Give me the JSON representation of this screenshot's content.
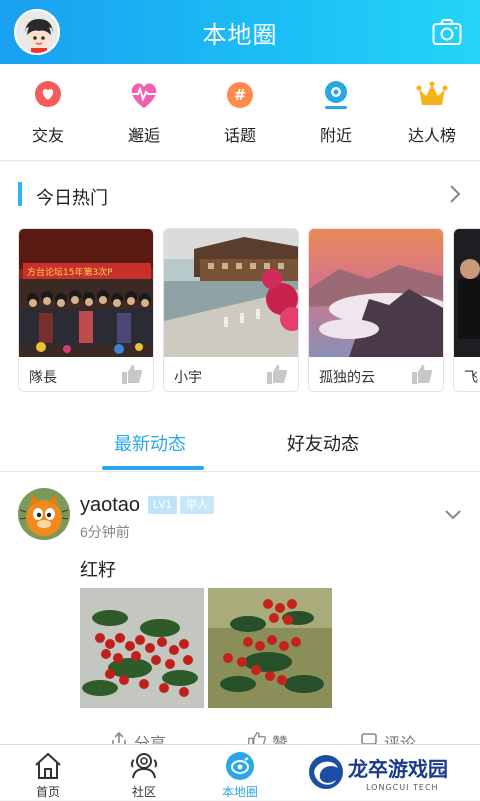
{
  "header": {
    "title": "本地圈"
  },
  "quick_actions": [
    {
      "label": "交友",
      "icon": "heart-chat-icon",
      "color": "#f45b5b"
    },
    {
      "label": "邂逅",
      "icon": "heartbeat-icon",
      "color": "#f05fb0"
    },
    {
      "label": "话题",
      "icon": "hashtag-icon",
      "color": "#ff8a4c"
    },
    {
      "label": "附近",
      "icon": "location-pin-icon",
      "color": "#2aa7ea"
    },
    {
      "label": "达人榜",
      "icon": "crown-icon",
      "color": "#f5b21a"
    }
  ],
  "hot": {
    "title": "今日热门",
    "cards": [
      {
        "name": "隊長"
      },
      {
        "name": "小宇"
      },
      {
        "name": "孤独的云"
      },
      {
        "name": "飞"
      }
    ]
  },
  "tabs": [
    {
      "label": "最新动态"
    },
    {
      "label": "好友动态"
    }
  ],
  "post": {
    "user": "yaotao",
    "level": "LV1",
    "tag": "举人",
    "time": "6分钟前",
    "text": "红籽",
    "actions": {
      "share": "分享",
      "like": "赞",
      "comment": "评论"
    }
  },
  "bottom_nav": [
    {
      "label": "首页",
      "icon": "home-icon"
    },
    {
      "label": "社区",
      "icon": "community-icon"
    },
    {
      "label": "本地圈",
      "icon": "local-circle-icon",
      "active": true
    }
  ],
  "watermark": {
    "text": "龙卒游戏园",
    "sub": "LONGCUI TECH"
  }
}
